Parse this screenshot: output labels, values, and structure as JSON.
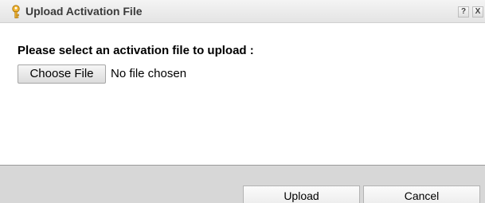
{
  "dialog": {
    "title": "Upload Activation File",
    "help_label": "?",
    "close_label": "X",
    "title_icon": "key-icon"
  },
  "body": {
    "prompt": "Please select an activation file to upload :",
    "choose_file_label": "Choose File",
    "file_status": "No file chosen"
  },
  "footer": {
    "upload_label": "Upload",
    "cancel_label": "Cancel"
  },
  "colors": {
    "titlebar": "#e8e8e8",
    "footer": "#d7d7d7",
    "key_icon": "#e8a317"
  }
}
